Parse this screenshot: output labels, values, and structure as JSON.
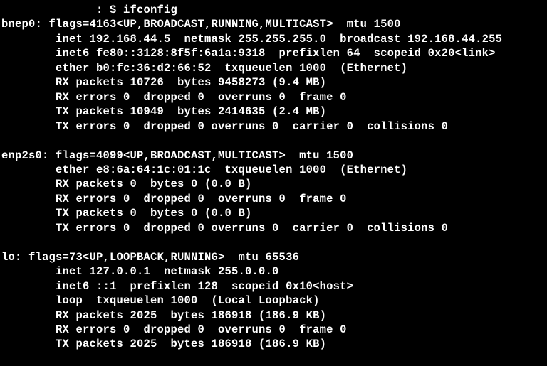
{
  "prompt": {
    "prefix": "              : $ ",
    "command": "ifconfig"
  },
  "interfaces": [
    {
      "name": "bnep0",
      "header": "bnep0: flags=4163<UP,BROADCAST,RUNNING,MULTICAST>  mtu 1500",
      "lines": [
        "        inet 192.168.44.5  netmask 255.255.255.0  broadcast 192.168.44.255",
        "        inet6 fe80::3128:8f5f:6a1a:9318  prefixlen 64  scopeid 0x20<link>",
        "        ether b0:fc:36:d2:66:52  txqueuelen 1000  (Ethernet)",
        "        RX packets 10726  bytes 9458273 (9.4 MB)",
        "        RX errors 0  dropped 0  overruns 0  frame 0",
        "        TX packets 10949  bytes 2414635 (2.4 MB)",
        "        TX errors 0  dropped 0 overruns 0  carrier 0  collisions 0"
      ]
    },
    {
      "name": "enp2s0",
      "header": "enp2s0: flags=4099<UP,BROADCAST,MULTICAST>  mtu 1500",
      "lines": [
        "        ether e8:6a:64:1c:01:1c  txqueuelen 1000  (Ethernet)",
        "        RX packets 0  bytes 0 (0.0 B)",
        "        RX errors 0  dropped 0  overruns 0  frame 0",
        "        TX packets 0  bytes 0 (0.0 B)",
        "        TX errors 0  dropped 0 overruns 0  carrier 0  collisions 0"
      ]
    },
    {
      "name": "lo",
      "header": "lo: flags=73<UP,LOOPBACK,RUNNING>  mtu 65536",
      "lines": [
        "        inet 127.0.0.1  netmask 255.0.0.0",
        "        inet6 ::1  prefixlen 128  scopeid 0x10<host>",
        "        loop  txqueuelen 1000  (Local Loopback)",
        "        RX packets 2025  bytes 186918 (186.9 KB)",
        "        RX errors 0  dropped 0  overruns 0  frame 0",
        "        TX packets 2025  bytes 186918 (186.9 KB)"
      ]
    }
  ]
}
